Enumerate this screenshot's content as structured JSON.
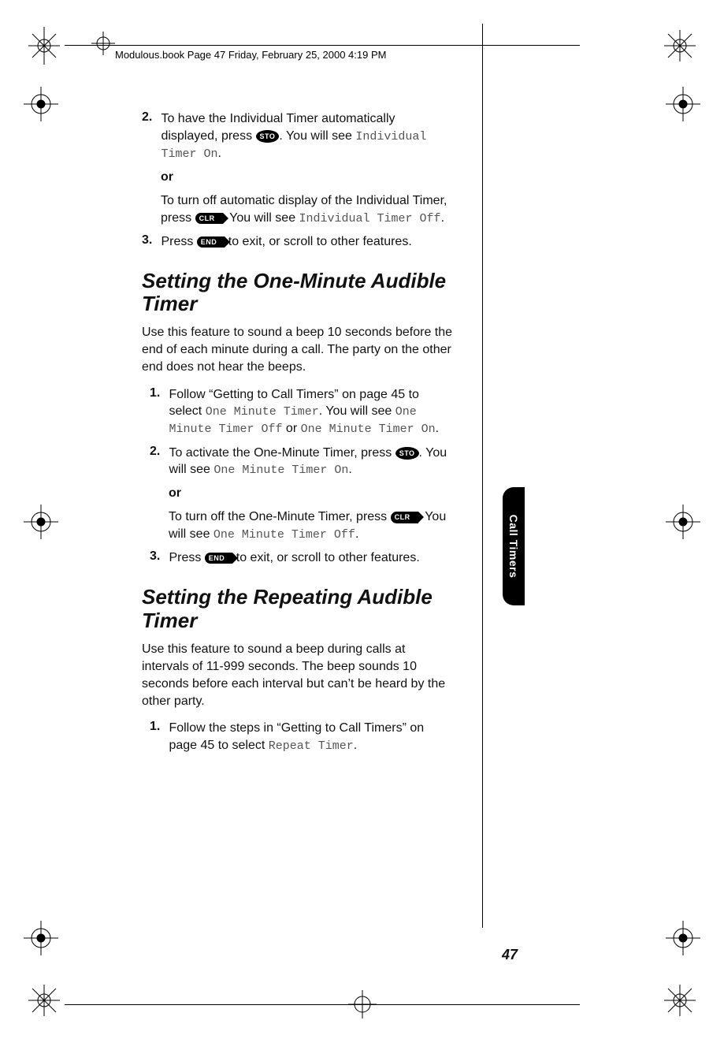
{
  "header": {
    "crop_text": "Modulous.book  Page 47  Friday, February 25, 2000  4:19 PM"
  },
  "side_tab": "Call Timers",
  "page_number": "47",
  "keys": {
    "sto": "STO",
    "clr": "CLR",
    "end": "END"
  },
  "content": {
    "step2a_pre": "To have the Individual Timer automatically displayed, press ",
    "step2a_post": ". You will see ",
    "step2a_display": "Individual Timer On",
    "or": "or",
    "step2b_pre": "To turn off automatic display of the Individual Timer, press ",
    "step2b_post": ". You will see ",
    "step2b_display": "Individual Timer Off",
    "step3_pre": "Press ",
    "step3_post": " to exit, or scroll to other features.",
    "num2": "2.",
    "num3": "3.",
    "num1": "1.",
    "section1_title": "Setting the One-Minute Audible Timer",
    "section1_intro": "Use this feature to sound a beep 10 seconds before the end of each minute during a call. The party on the other end does not hear the beeps.",
    "s1_step1_pre": "Follow “Getting to Call Timers” on page 45 to select ",
    "s1_step1_d1": "One Minute Timer",
    "s1_step1_mid": ". You will see ",
    "s1_step1_d2": "One Minute Timer Off",
    "s1_step1_or": " or ",
    "s1_step1_d3": "One Minute Timer On",
    "period": ".",
    "s1_step2a_pre": "To activate the One-Minute Timer, press ",
    "s1_step2a_post": ". You will see ",
    "s1_step2a_d": "One Minute Timer On",
    "s1_step2b_pre": "To turn off the One-Minute Timer, press ",
    "s1_step2b_post": ". You will see ",
    "s1_step2b_d": "One Minute Timer Off",
    "section2_title": "Setting the Repeating Audible Timer",
    "section2_intro": "Use this feature to sound a beep during calls at intervals of 11-999 seconds. The beep sounds 10 seconds before each interval but can’t be heard by the other party.",
    "s2_step1_pre": "Follow the steps in “Getting to Call Timers” on page 45 to select ",
    "s2_step1_d": "Repeat Timer"
  }
}
